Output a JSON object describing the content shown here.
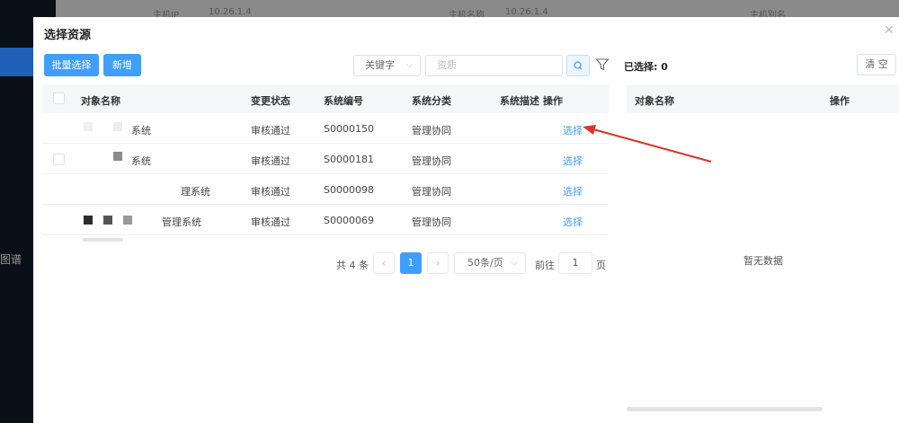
{
  "background": {
    "sidebar_label": "图谱",
    "top_row": [
      "主机IP",
      "10.26.1.4",
      "主机名称",
      "10.26.1.4",
      "主机别名"
    ]
  },
  "dialog": {
    "title": "选择资源",
    "close_icon": "close-icon"
  },
  "toolbar": {
    "batch_select_label": "批量选择",
    "add_label": "新增",
    "keyword_select_value": "关键字",
    "search_placeholder": "资质",
    "search_icon": "search-icon",
    "filter_icon": "filter-icon",
    "selected_label": "已选择: 0",
    "clear_label": "清 空"
  },
  "table": {
    "columns": [
      "对象名称",
      "变更状态",
      "系统编号",
      "系统分类",
      "系统描述",
      "操作"
    ],
    "rows": [
      {
        "name": "系统",
        "status": "审核通过",
        "code": "S0000150",
        "category": "管理协同",
        "description": "",
        "action": "选择"
      },
      {
        "name": "系统",
        "status": "审核通过",
        "code": "S0000181",
        "category": "管理协同",
        "description": "",
        "action": "选择"
      },
      {
        "name": "理系统",
        "status": "审核通过",
        "code": "S0000098",
        "category": "管理协同",
        "description": "",
        "action": "选择"
      },
      {
        "name": "管理系统",
        "status": "审核通过",
        "code": "S0000069",
        "category": "管理协同",
        "description": "",
        "action": "选择"
      }
    ]
  },
  "pagination": {
    "total_label": "共 4 条",
    "prev": "‹",
    "current_page": "1",
    "next": "›",
    "page_size": "50条/页",
    "goto_label": "前往",
    "goto_value": "1",
    "page_suffix": "页"
  },
  "selected_panel": {
    "columns": [
      "对象名称",
      "操作"
    ],
    "empty_text": "暂无数据"
  },
  "colors": {
    "primary": "#409eff",
    "arrow": "#d9342b"
  }
}
